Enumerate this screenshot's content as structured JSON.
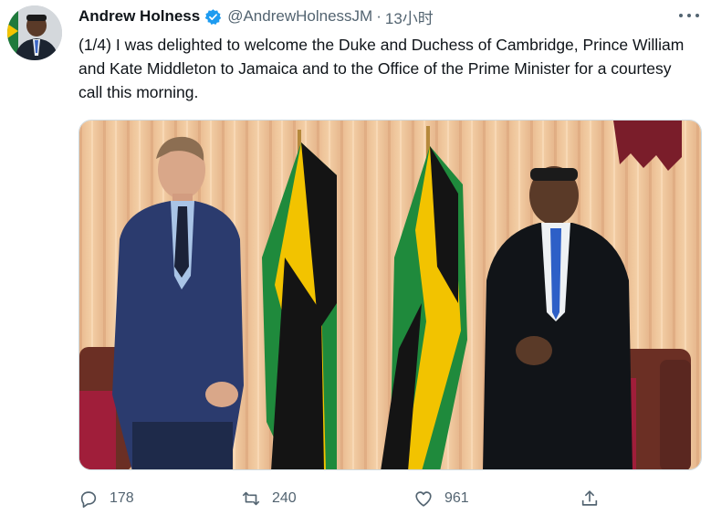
{
  "tweet": {
    "author_name": "Andrew Holness",
    "handle": "@AndrewHolnessJM",
    "separator": "·",
    "time": "13小时",
    "text": "(1/4) I was delighted to welcome the Duke and Duchess of Cambridge, Prince William and Kate Middleton to Jamaica and to the Office of the Prime Minister for a courtesy call this morning."
  },
  "actions": {
    "reply_count": "178",
    "retweet_count": "240",
    "like_count": "961"
  },
  "icons": {
    "verified": "verified-badge-icon",
    "more": "more-icon",
    "reply": "reply-icon",
    "retweet": "retweet-icon",
    "like": "like-icon",
    "share": "share-icon"
  },
  "colors": {
    "text_primary": "#0f1419",
    "text_secondary": "#536471",
    "verified_blue": "#1d9bf0"
  }
}
